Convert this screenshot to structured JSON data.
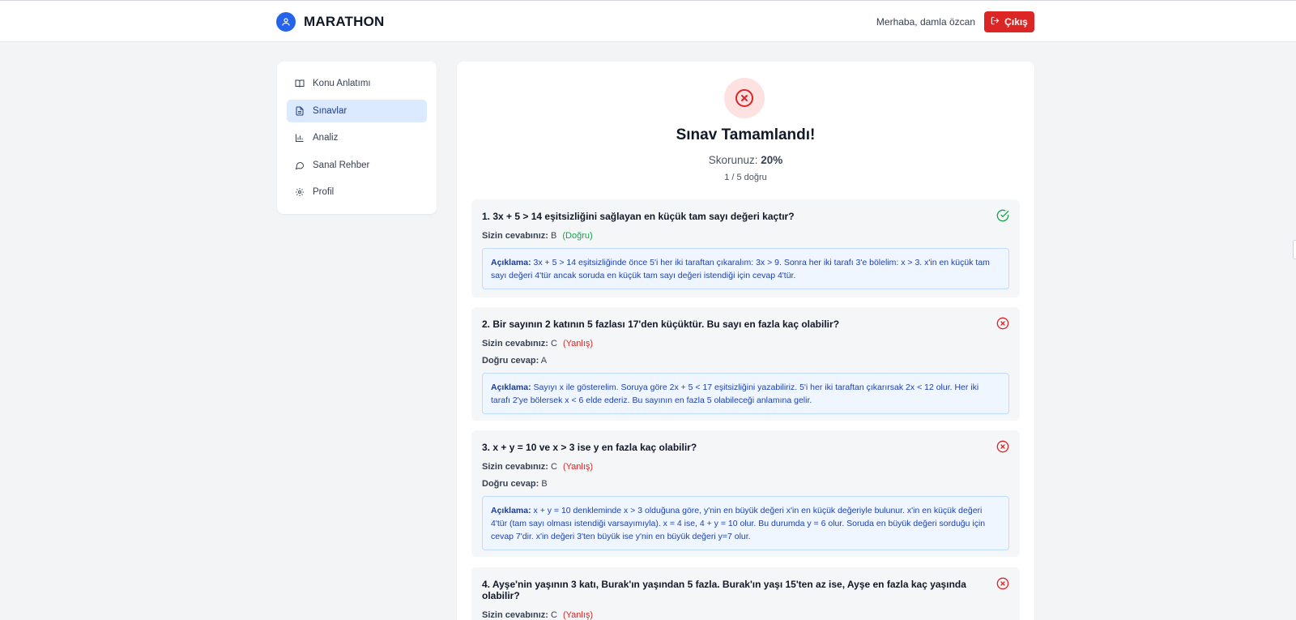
{
  "header": {
    "brand": "MARATHON",
    "greeting": "Merhaba, damla özcan",
    "logout_label": "Çıkış"
  },
  "sidebar": {
    "items": [
      {
        "label": "Konu Anlatımı",
        "icon": "book-open-icon",
        "active": false
      },
      {
        "label": "Sınavlar",
        "icon": "document-icon",
        "active": true
      },
      {
        "label": "Analiz",
        "icon": "bar-chart-icon",
        "active": false
      },
      {
        "label": "Sanal Rehber",
        "icon": "chat-bubble-icon",
        "active": false
      },
      {
        "label": "Profil",
        "icon": "gear-icon",
        "active": false
      }
    ]
  },
  "result": {
    "title": "Sınav Tamamlandı!",
    "score_label": "Skorunuz:",
    "score_value": "20%",
    "correct_count": "1 / 5 doğru"
  },
  "questions": [
    {
      "text": "1. 3x + 5 > 14 eşitsizliğini sağlayan en küçük tam sayı değeri kaçtır?",
      "status_icon": "check-circle-icon",
      "your_answer_label": "Sizin cevabınız:",
      "your_answer": "B",
      "verdict": "(Doğru)",
      "explanation_label": "Açıklama:",
      "explanation": "3x + 5 > 14 eşitsizliğinde önce 5'i her iki taraftan çıkaralım: 3x > 9. Sonra her iki tarafı 3'e bölelim: x > 3. x'in en küçük tam sayı değeri 4'tür ancak soruda en küçük tam sayı değeri istendiği için cevap 4'tür."
    },
    {
      "text": "2. Bir sayının 2 katının 5 fazlası 17'den küçüktür. Bu sayı en fazla kaç olabilir?",
      "status_icon": "x-circle-icon",
      "your_answer_label": "Sizin cevabınız:",
      "your_answer": "C",
      "verdict": "(Yanlış)",
      "correct_label": "Doğru cevap:",
      "correct_answer": "A",
      "explanation_label": "Açıklama:",
      "explanation": "Sayıyı x ile gösterelim. Soruya göre 2x + 5 < 17 eşitsizliğini yazabiliriz. 5'i her iki taraftan çıkarırsak 2x < 12 olur. Her iki tarafı 2'ye bölersek x < 6 elde ederiz. Bu sayının en fazla 5 olabileceği anlamına gelir."
    },
    {
      "text": "3. x + y = 10 ve x > 3 ise y en fazla kaç olabilir?",
      "status_icon": "x-circle-icon",
      "your_answer_label": "Sizin cevabınız:",
      "your_answer": "C",
      "verdict": "(Yanlış)",
      "correct_label": "Doğru cevap:",
      "correct_answer": "B",
      "explanation_label": "Açıklama:",
      "explanation": "x + y = 10 denkleminde x > 3 olduğuna göre, y'nin en büyük değeri x'in en küçük değeriyle bulunur. x'in en küçük değeri 4'tür (tam sayı olması istendiği varsayımıyla). x = 4 ise, 4 + y = 10 olur. Bu durumda y = 6 olur. Soruda en büyük değeri sorduğu için cevap 7'dir. x'in değeri 3'ten büyük ise y'nin en büyük değeri y=7 olur."
    },
    {
      "text": "4. Ayşe'nin yaşının 3 katı, Burak'ın yaşından 5 fazla. Burak'ın yaşı 15'ten az ise, Ayşe en fazla kaç yaşında olabilir?",
      "status_icon": "x-circle-icon",
      "your_answer_label": "Sizin cevabınız:",
      "your_answer": "C",
      "verdict": "(Yanlış)"
    }
  ],
  "colors": {
    "brand_blue": "#2563eb",
    "danger_red": "#dc2626",
    "success_green": "#16a34a",
    "active_nav_bg": "#dbeafe"
  }
}
